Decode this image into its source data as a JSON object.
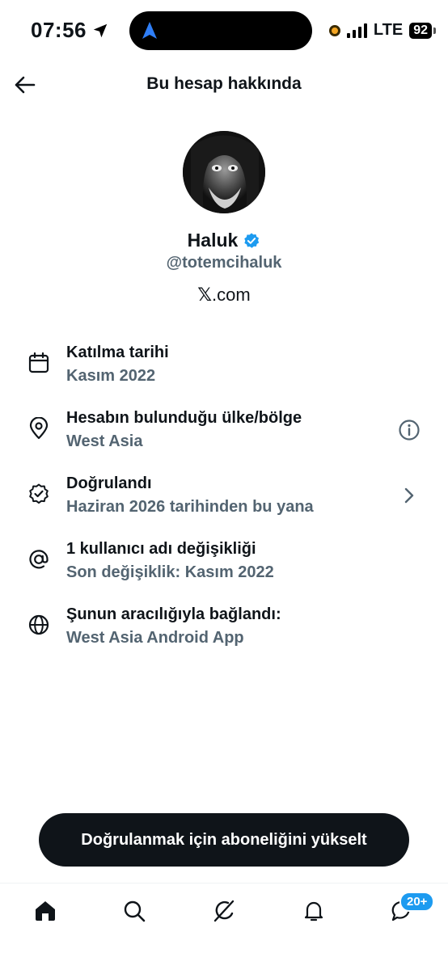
{
  "status_bar": {
    "time": "07:56",
    "network": "LTE",
    "battery": "92"
  },
  "header": {
    "title": "Bu hesap hakkında"
  },
  "profile": {
    "name": "Haluk",
    "handle": "@totemcihaluk",
    "site_symbol": "𝕏",
    "site_suffix": ".com"
  },
  "info_items": [
    {
      "icon": "calendar-icon",
      "title": "Katılma tarihi",
      "subtitle": "Kasım 2022"
    },
    {
      "icon": "location-pin-icon",
      "title": "Hesabın bulunduğu ülke/bölge",
      "subtitle": "West Asia",
      "action": "info-icon"
    },
    {
      "icon": "verified-badge-icon",
      "title": "Doğrulandı",
      "subtitle": "Haziran 2026 tarihinden bu yana",
      "action": "chevron-right-icon"
    },
    {
      "icon": "at-sign-icon",
      "title": "1 kullanıcı adı değişikliği",
      "subtitle": "Son değişiklik: Kasım 2022"
    },
    {
      "icon": "globe-icon",
      "title": "Şunun aracılığıyla bağlandı:",
      "subtitle": "West Asia Android App"
    }
  ],
  "cta": {
    "label": "Doğrulanmak için aboneliğini yükselt"
  },
  "bottom_nav": {
    "items": [
      "home-icon",
      "search-icon",
      "grok-icon",
      "notifications-icon",
      "messages-icon"
    ],
    "messages_badge": "20+"
  },
  "colors": {
    "primary_text": "#0f1419",
    "secondary_text": "#536471",
    "accent": "#1d9bf0"
  }
}
